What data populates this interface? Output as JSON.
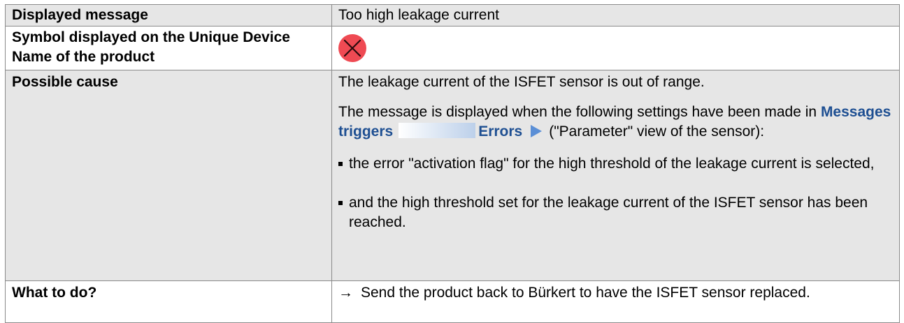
{
  "rows": {
    "message": {
      "label": "Displayed message",
      "value": "Too high leakage current"
    },
    "symbol": {
      "label": "Symbol displayed on the Unique Device Name of the product",
      "icon": "error-cross-icon",
      "icon_color": "#ef4a53"
    },
    "cause": {
      "label": "Possible cause",
      "line1": "The leakage current of the ISFET sensor is out of range.",
      "line2_prefix": "The message is displayed when the following settings have been made in",
      "menu_item1": "Messages triggers",
      "menu_item2": "Errors",
      "line2_suffix": "(\"Parameter\" view of the sensor):",
      "bullets": [
        "the error \"activation flag\" for the high threshold of the leakage current is selected,",
        "and the high threshold set for the leakage current of the ISFET sensor has been reached."
      ]
    },
    "todo": {
      "label": "What to do?",
      "arrow": "→",
      "text": "Send the product back to Bürkert to have the ISFET sensor replaced."
    }
  },
  "colors": {
    "shade": "#e6e6e6",
    "border": "#8a8a8a",
    "menu_path": "#1e4f92",
    "nav_arrow": "#5b8fd6"
  }
}
